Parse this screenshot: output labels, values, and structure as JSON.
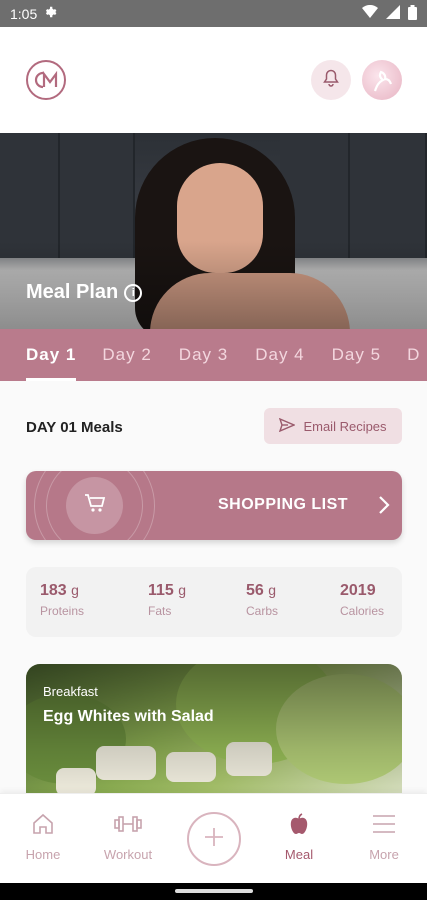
{
  "status_bar": {
    "time": "1:05"
  },
  "hero": {
    "title": "Meal Plan"
  },
  "day_tabs": [
    {
      "label": "Day 1",
      "active": true
    },
    {
      "label": "Day 2",
      "active": false
    },
    {
      "label": "Day 3",
      "active": false
    },
    {
      "label": "Day 4",
      "active": false
    },
    {
      "label": "Day 5",
      "active": false
    },
    {
      "label": "D",
      "active": false
    }
  ],
  "meals": {
    "title": "DAY 01 Meals",
    "email_button": "Email Recipes",
    "shopping_list": "SHOPPING LIST"
  },
  "macros": [
    {
      "value": "183",
      "unit": "g",
      "label": "Proteins"
    },
    {
      "value": "115",
      "unit": "g",
      "label": "Fats"
    },
    {
      "value": "56",
      "unit": "g",
      "label": "Carbs"
    },
    {
      "value": "2019",
      "unit": "",
      "label": "Calories"
    }
  ],
  "recipe": {
    "meal_type": "Breakfast",
    "name": "Egg Whites with Salad"
  },
  "nav": {
    "home": "Home",
    "workout": "Workout",
    "meal": "Meal",
    "more": "More"
  },
  "colors": {
    "accent": "#b97b8c",
    "accent_dark": "#a5596d",
    "muted": "#c7a3ad"
  },
  "icons": {
    "logo": "cm-logo",
    "bell": "bell-icon",
    "cart": "cart-icon",
    "send": "send-icon",
    "plus": "plus-icon"
  }
}
